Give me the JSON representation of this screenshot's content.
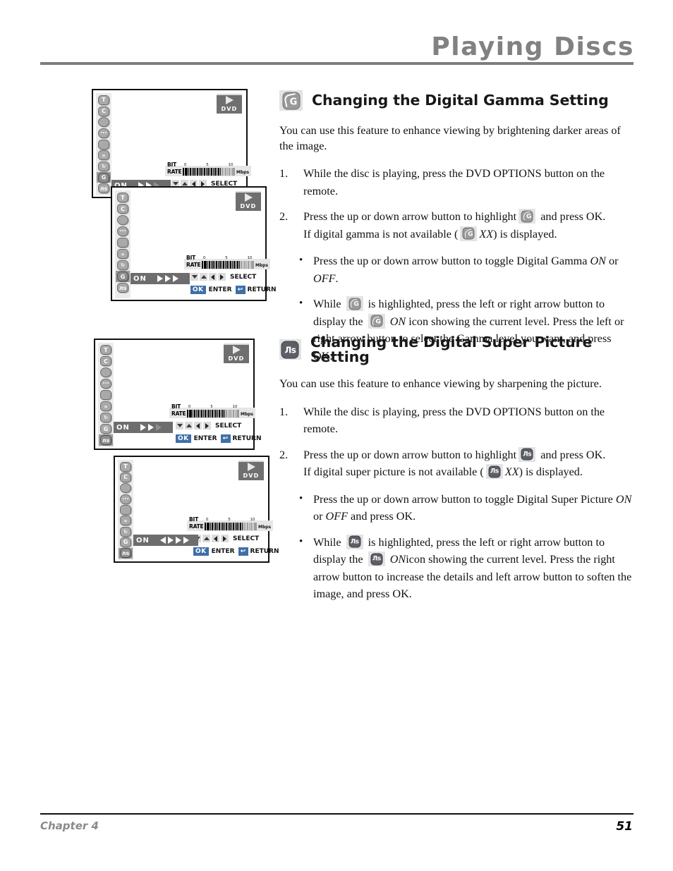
{
  "header": {
    "title": "Playing Discs"
  },
  "footer": {
    "chapter": "Chapter 4",
    "page": "51"
  },
  "sections": [
    {
      "icon": "gamma-icon",
      "heading": "Changing the Digital Gamma Setting",
      "intro": "You can use this feature to enhance viewing by brightening darker areas of the image.",
      "steps": [
        {
          "num": "1.",
          "text": "While the disc is playing, press the DVD OPTIONS button on the remote."
        },
        {
          "num": "2.",
          "text_a": "Press the up or down arrow button to highlight",
          "text_b": "and press OK.",
          "text_c": "If digital gamma is not available (",
          "text_d": "XX",
          "text_e": ") is displayed."
        }
      ],
      "bullets": [
        {
          "a": "Press the up or down arrow button to toggle Digital Gamma ",
          "i1": "ON",
          "b": " or ",
          "i2": "OFF",
          "c": "."
        },
        {
          "a": "While",
          "b": "is highlighted, press the left or right arrow button to display the",
          "i1": "ON",
          "c": "icon showing the current level. Press the left or right arrow button to select the Gamma level you want, and press OK."
        }
      ]
    },
    {
      "icon": "super-picture-icon",
      "heading": "Changing the Digital Super Picture Setting",
      "intro": "You can use this feature to enhance viewing by sharpening the picture.",
      "steps": [
        {
          "num": "1.",
          "text": "While the disc is playing, press the DVD OPTIONS button on the remote."
        },
        {
          "num": "2.",
          "text_a": "Press the up or down arrow button to highlight",
          "text_b": "and press OK.",
          "text_c": "If digital super picture is not available (",
          "text_d": "XX",
          "text_e": ") is displayed."
        }
      ],
      "bullets": [
        {
          "a": "Press the up or down arrow button to toggle Digital Super Picture ",
          "i1": "ON",
          "b": " or ",
          "i2": "OFF",
          "c": " and press OK."
        },
        {
          "a": "While",
          "b": "is highlighted, press the left or right arrow button to display the",
          "i1": "ON",
          "c": "icon showing the current level. Press the right arrow button to increase the details and left arrow button to soften the image, and press OK."
        }
      ]
    }
  ],
  "osd": {
    "dvd_label": "DVD",
    "bitrate_label": "BIT RATE",
    "bitrate_unit": "Mbps",
    "bitrate_scale": [
      "0",
      "5",
      "10"
    ],
    "select_label": "SELECT",
    "ok_label": "OK",
    "enter_label": "ENTER",
    "return_label": "RETURN",
    "on_label": "ON",
    "rail_icons": [
      "title-icon",
      "chapter-icon",
      "time-icon",
      "subtitle-icon",
      "angle-icon",
      "audio-icon",
      "zoom-icon",
      "gamma-icon",
      "super-picture-icon"
    ],
    "rail_glyphs": [
      "T",
      "C",
      "",
      "",
      "",
      "",
      "",
      "G",
      "лs"
    ],
    "screens": [
      {
        "name": "gamma-screen-1",
        "selected": 7,
        "on_arrows": "rrr_dim",
        "show_enter_row": false
      },
      {
        "name": "gamma-screen-2",
        "selected": 7,
        "on_arrows": "rrr",
        "show_enter_row": true
      },
      {
        "name": "super-screen-1",
        "selected": 8,
        "on_arrows": "rrr_dim",
        "show_enter_row": true
      },
      {
        "name": "super-screen-2",
        "selected": 8,
        "on_arrows": "lrrr",
        "show_enter_row": true
      }
    ]
  }
}
